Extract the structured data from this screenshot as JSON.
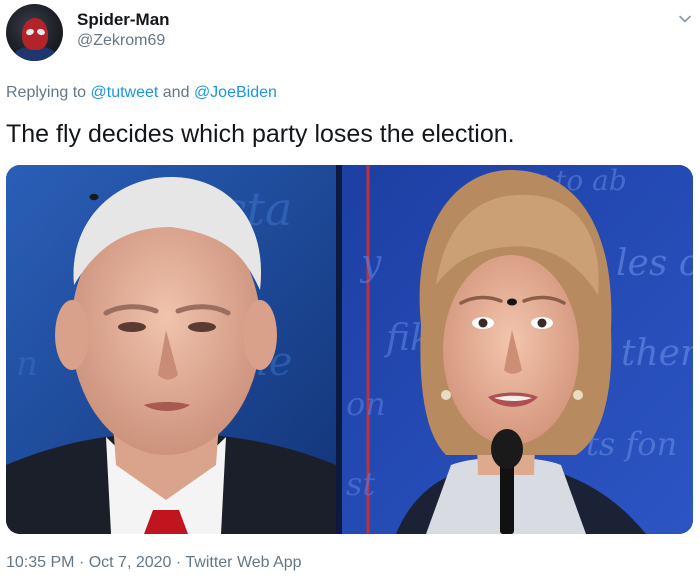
{
  "tweet": {
    "author": {
      "display_name": "Spider-Man",
      "handle": "@Zekrom69",
      "avatar_icon": "spiderman-avatar"
    },
    "reply": {
      "prefix": "Replying to",
      "mention_1": "@tutweet",
      "conjunction": "and",
      "mention_2": "@JoeBiden"
    },
    "text": "The fly decides which party loses the election.",
    "media": {
      "icon": "debate-photo-collage",
      "panels": [
        "man-at-debate-with-fly",
        "woman-at-debate-with-fly"
      ]
    },
    "timestamp": {
      "time": "10:35 PM",
      "separator_1": "·",
      "date": "Oct 7, 2020",
      "separator_2": "·",
      "source": "Twitter Web App"
    },
    "menu_icon": "chevron-down-icon"
  },
  "colors": {
    "link": "#1b95e0",
    "secondary_text": "#657786",
    "primary_text": "#14171a",
    "media_blue": "#1a3f8e"
  }
}
